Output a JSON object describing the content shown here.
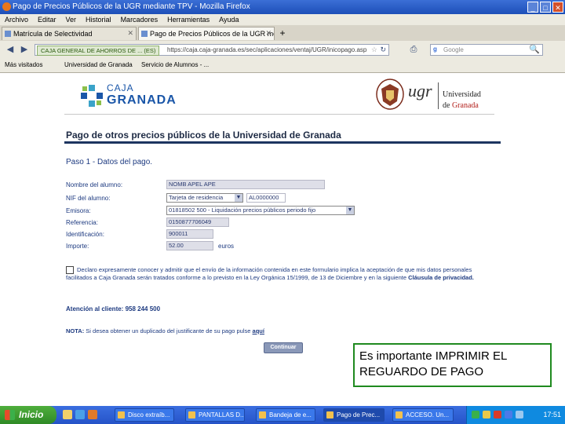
{
  "window": {
    "title": "Pago de Precios Públicos de la UGR mediante TPV - Mozilla Firefox",
    "buttons": {
      "minimize": "_",
      "maximize": "□",
      "close": "✕"
    }
  },
  "menu": [
    "Archivo",
    "Editar",
    "Ver",
    "Historial",
    "Marcadores",
    "Herramientas",
    "Ayuda"
  ],
  "tabs": [
    {
      "label": "Matrícula de Selectividad",
      "close": "✕"
    },
    {
      "label": "Pago de Precios Públicos de la UGR media...",
      "close": "✕"
    }
  ],
  "new_tab": "+",
  "nav": {
    "back": "◀",
    "forward": "▶",
    "site_identity": "CAJA GENERAL DE AHORROS DE ... (ES)",
    "url": "https://caja.caja-granada.es/sec/aplicaciones/ventaj/UGR/inicopago.asp",
    "star": "☆",
    "reload": "↻",
    "search_engine": "g",
    "search_placeholder": "Google",
    "search_button": "🔍"
  },
  "bookmarks": [
    "Más visitados",
    "Universidad de Granada",
    "Servicio de Alumnos - ..."
  ],
  "logos": {
    "caja_line1": "CAJA",
    "caja_line2": "GRANADA",
    "ugr_word": "ugr",
    "ugr_univ": "Universidad",
    "ugr_de": "de ",
    "ugr_granada": "Granada"
  },
  "page": {
    "heading": "Pago de otros precios públicos de la Universidad de Granada",
    "step": "Paso 1 - Datos del pago.",
    "fields": [
      {
        "label": "Nombre del alumno:",
        "value": "NOMB APEL APE"
      },
      {
        "label": "NIF del alumno:",
        "select": "Tarjeta de residencia",
        "value": "AL0000000"
      },
      {
        "label": "Emisora:",
        "select": "01818502 500 - Liquidación precios públicos periodo fijo"
      },
      {
        "label": "Referencia:",
        "value": "0150877706049"
      },
      {
        "label": "Identificación:",
        "value": "900011"
      },
      {
        "label": "Importe:",
        "value": "52.00",
        "unit": "euros"
      }
    ],
    "consent": "Declaro expresamente conocer y admitir que el envío de la información contenida en este formulario implica la aceptación de que mis datos personales facilitados a Caja Granada serán tratados conforme a lo previsto en la Ley Orgánica 15/1999, de 13 de Diciembre y en la siguiente ",
    "consent_link": "Cláusula de privacidad.",
    "atencion": "Atención al cliente: 958 244 500",
    "nota_label": "NOTA:",
    "nota_text": " Si desea obtener un duplicado del justificante de su pago pulse ",
    "nota_link": "aquí",
    "button": "Continuar"
  },
  "callout": "Es importante IMPRIMIR EL REGUARDO DE PAGO",
  "taskbar": {
    "start": "Inicio",
    "tasks": [
      "Disco extraíb...",
      "PANTALLAS D...",
      "Bandeja de e...",
      "Pago de Prec...",
      "ACCESO. Un..."
    ],
    "clock": "17:51"
  },
  "colors": {
    "accent": "#1d3560",
    "callout_border": "#1f8a1f",
    "link": "#1d3a80"
  }
}
